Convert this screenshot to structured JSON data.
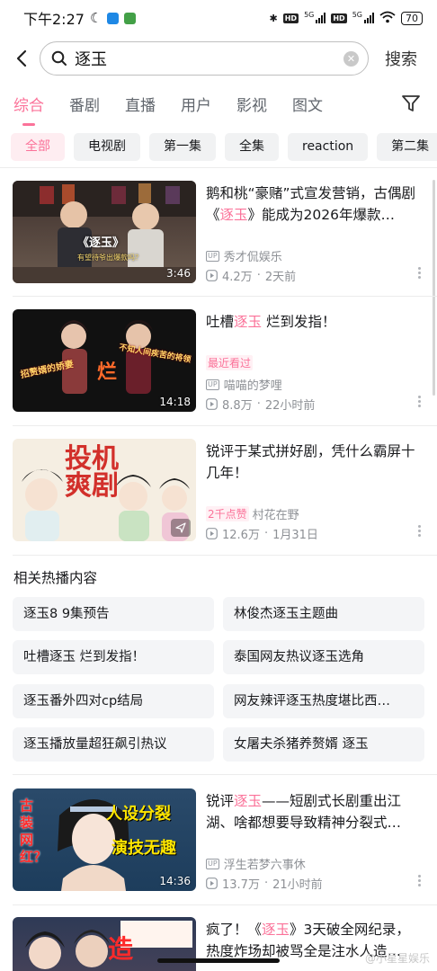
{
  "status_bar": {
    "time": "下午2:27",
    "network_1": "5G",
    "network_2": "5G",
    "battery": "70",
    "hd_label": "HD"
  },
  "search": {
    "query": "逐玉",
    "search_button": "搜索"
  },
  "tabs": [
    {
      "label": "综合",
      "active": true
    },
    {
      "label": "番剧"
    },
    {
      "label": "直播"
    },
    {
      "label": "用户"
    },
    {
      "label": "影视"
    },
    {
      "label": "图文"
    }
  ],
  "chips": [
    {
      "label": "全部",
      "active": true
    },
    {
      "label": "电视剧"
    },
    {
      "label": "第一集"
    },
    {
      "label": "全集"
    },
    {
      "label": "reaction"
    },
    {
      "label": "第二集"
    }
  ],
  "videos": [
    {
      "title_pre": "鹅和桃“豪赌”式宣发营销，古偶剧《",
      "title_hl": "逐玉",
      "title_post": "》能成为2026年爆款…",
      "duration": "3:46",
      "author": "秀才侃娱乐",
      "views": "4.2万",
      "time": "2天前",
      "thumb_text_1": "《逐玉》",
      "thumb_text_2": "有望待爷出爆款吗？"
    },
    {
      "title_pre": "吐槽",
      "title_hl": "逐玉",
      "title_post": " 烂到发指！",
      "duration": "14:18",
      "tag": "最近看过",
      "author": "喵喵的梦哩",
      "views": "8.8万",
      "time": "22小时前",
      "thumb_text_1": "招赘婿的娇妻",
      "thumb_text_2": "烂",
      "thumb_text_3": "不知人间疾苦的将领"
    },
    {
      "title_pre": "锐评于某式拼好剧，凭什么霸屏十几年！",
      "title_hl": "",
      "title_post": "",
      "tag": "2千点赞",
      "author": "村花在野",
      "views": "12.6万",
      "time": "1月31日",
      "thumb_text_1": "投机爽剧"
    },
    {
      "title_pre": "锐评",
      "title_hl": "逐玉",
      "title_post": "——短剧式长剧重出江湖、啥都想要导致精神分裂式…",
      "duration": "14:36",
      "author": "浮生若梦六事休",
      "views": "13.7万",
      "time": "21小时前",
      "thumb_text_1": "古装网红？",
      "thumb_text_2": "人设分裂",
      "thumb_text_3": "演技无趣"
    },
    {
      "title_pre": "疯了！《",
      "title_hl": "逐玉",
      "title_post": "》3天破全网纪录，热度炸场却被骂全是注水人造…",
      "thumb_text_1": "造"
    }
  ],
  "related": {
    "title": "相关热播内容",
    "items": [
      "逐玉8 9集预告",
      "林俊杰逐玉主题曲",
      "吐槽逐玉 烂到发指！",
      "泰国网友热议逐玉选角",
      "逐玉番外四对cp结局",
      "网友辣评逐玉热度堪比西…",
      "逐玉播放量超狂飙引热议",
      "女屠夫杀猪养赘婿 逐玉"
    ]
  },
  "watermark": "@小星星娱乐",
  "colors": {
    "accent": "#fb7299",
    "text": "#18191c",
    "meta": "#8d9095",
    "chip_bg": "#f1f2f3"
  }
}
